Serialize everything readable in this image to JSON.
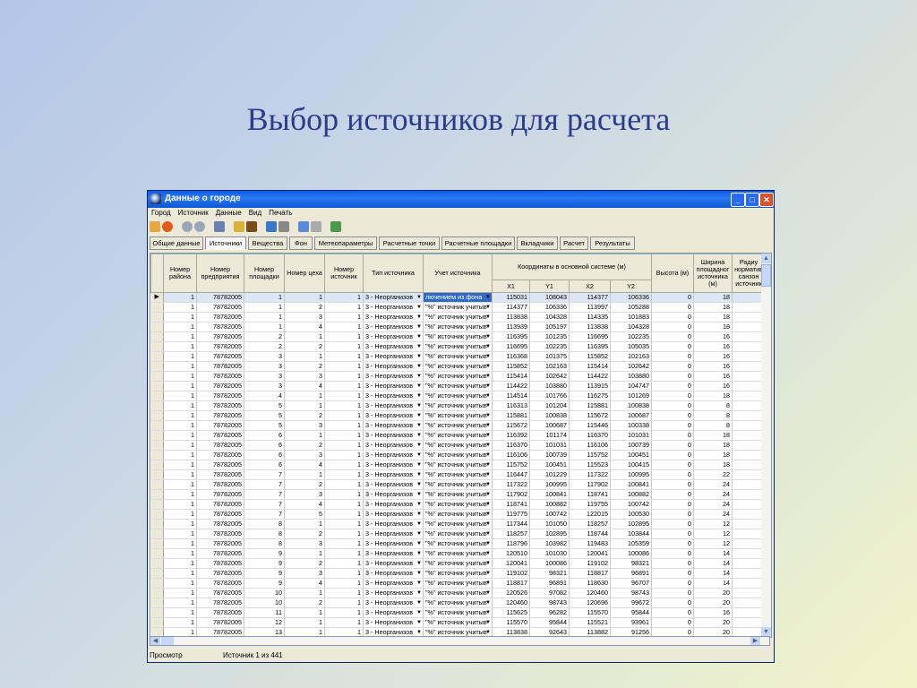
{
  "slide": {
    "title": "Выбор источников для расчета"
  },
  "window": {
    "title": "Данные о городе"
  },
  "menu": [
    "Город",
    "Источник",
    "Данные",
    "Вид",
    "Печать"
  ],
  "tabs": [
    {
      "label": "Общие данные",
      "active": false
    },
    {
      "label": "Источники",
      "active": true
    },
    {
      "label": "Вещества",
      "active": false
    },
    {
      "label": "Фон",
      "active": false
    },
    {
      "label": "Метеопараметры",
      "active": false
    },
    {
      "label": "Расчетные точки",
      "active": false
    },
    {
      "label": "Расчетные площадки",
      "active": false
    },
    {
      "label": "Вкладчики",
      "active": false
    },
    {
      "label": "Расчет",
      "active": false
    },
    {
      "label": "Результаты",
      "active": false
    }
  ],
  "table": {
    "headers": {
      "district": "Номер района",
      "enterprise": "Номер предприятия",
      "site": "Номер площадки",
      "shop": "Номер цеха",
      "source": "Номер источник",
      "type": "Тип источника",
      "accounting": "Учет источника",
      "coords": "Координаты в основной системе (м)",
      "x1": "X1",
      "y1": "Y1",
      "x2": "X2",
      "y2": "Y2",
      "height": "Высота (м)",
      "width": "Ширина площадног источника (м)",
      "radius": "Радиу норматив санзон источник"
    },
    "type_value": "3 - Неорганизов",
    "accounting_selected": "лючением из фона",
    "accounting_value": "\"%\" источник учитыв",
    "rows": [
      [
        "1",
        "78782005",
        "1",
        "1",
        "1",
        "115031",
        "108043",
        "114377",
        "106336",
        "0",
        "18"
      ],
      [
        "1",
        "78782005",
        "1",
        "2",
        "1",
        "114377",
        "106336",
        "113997",
        "105288",
        "0",
        "18"
      ],
      [
        "1",
        "78782005",
        "1",
        "3",
        "1",
        "113838",
        "104328",
        "114335",
        "101883",
        "0",
        "18"
      ],
      [
        "1",
        "78782005",
        "1",
        "4",
        "1",
        "113939",
        "105197",
        "113838",
        "104328",
        "0",
        "18"
      ],
      [
        "1",
        "78782005",
        "2",
        "1",
        "1",
        "116395",
        "101235",
        "116695",
        "102235",
        "0",
        "16"
      ],
      [
        "1",
        "78782005",
        "2",
        "2",
        "1",
        "116695",
        "102235",
        "116395",
        "105035",
        "0",
        "16"
      ],
      [
        "1",
        "78782005",
        "3",
        "1",
        "1",
        "116368",
        "101375",
        "115852",
        "102163",
        "0",
        "16"
      ],
      [
        "1",
        "78782005",
        "3",
        "2",
        "1",
        "115852",
        "102163",
        "115414",
        "102642",
        "0",
        "16"
      ],
      [
        "1",
        "78782005",
        "3",
        "3",
        "1",
        "115414",
        "102642",
        "114422",
        "103880",
        "0",
        "16"
      ],
      [
        "1",
        "78782005",
        "3",
        "4",
        "1",
        "114422",
        "103880",
        "113915",
        "104747",
        "0",
        "16"
      ],
      [
        "1",
        "78782005",
        "4",
        "1",
        "1",
        "114514",
        "101766",
        "116275",
        "101269",
        "0",
        "18"
      ],
      [
        "1",
        "78782005",
        "5",
        "1",
        "1",
        "116313",
        "101204",
        "115881",
        "100838",
        "0",
        "8"
      ],
      [
        "1",
        "78782005",
        "5",
        "2",
        "1",
        "115881",
        "100838",
        "115672",
        "100687",
        "0",
        "8"
      ],
      [
        "1",
        "78782005",
        "5",
        "3",
        "1",
        "115672",
        "100687",
        "115446",
        "100338",
        "0",
        "8"
      ],
      [
        "1",
        "78782005",
        "6",
        "1",
        "1",
        "116392",
        "101174",
        "116370",
        "101031",
        "0",
        "18"
      ],
      [
        "1",
        "78782005",
        "6",
        "2",
        "1",
        "116370",
        "101031",
        "116106",
        "100739",
        "0",
        "18"
      ],
      [
        "1",
        "78782005",
        "6",
        "3",
        "1",
        "116106",
        "100739",
        "115752",
        "100451",
        "0",
        "18"
      ],
      [
        "1",
        "78782005",
        "6",
        "4",
        "1",
        "115752",
        "100451",
        "115523",
        "100415",
        "0",
        "18"
      ],
      [
        "1",
        "78782005",
        "7",
        "1",
        "1",
        "116447",
        "101229",
        "117322",
        "100995",
        "0",
        "22"
      ],
      [
        "1",
        "78782005",
        "7",
        "2",
        "1",
        "117322",
        "100995",
        "117902",
        "100841",
        "0",
        "24"
      ],
      [
        "1",
        "78782005",
        "7",
        "3",
        "1",
        "117902",
        "100841",
        "118741",
        "100882",
        "0",
        "24"
      ],
      [
        "1",
        "78782005",
        "7",
        "4",
        "1",
        "118741",
        "100882",
        "119755",
        "100742",
        "0",
        "24"
      ],
      [
        "1",
        "78782005",
        "7",
        "5",
        "1",
        "119775",
        "100742",
        "122015",
        "100530",
        "0",
        "24"
      ],
      [
        "1",
        "78782005",
        "8",
        "1",
        "1",
        "117344",
        "101050",
        "118257",
        "102895",
        "0",
        "12"
      ],
      [
        "1",
        "78782005",
        "8",
        "2",
        "1",
        "118257",
        "102895",
        "118744",
        "103844",
        "0",
        "12"
      ],
      [
        "1",
        "78782005",
        "8",
        "3",
        "1",
        "118796",
        "103982",
        "119483",
        "105359",
        "0",
        "12"
      ],
      [
        "1",
        "78782005",
        "9",
        "1",
        "1",
        "120510",
        "101030",
        "120041",
        "100086",
        "0",
        "14"
      ],
      [
        "1",
        "78782005",
        "9",
        "2",
        "1",
        "120041",
        "100086",
        "119102",
        "98321",
        "0",
        "14"
      ],
      [
        "1",
        "78782005",
        "9",
        "3",
        "1",
        "119102",
        "98321",
        "118817",
        "96891",
        "0",
        "14"
      ],
      [
        "1",
        "78782005",
        "9",
        "4",
        "1",
        "118817",
        "96891",
        "118630",
        "96707",
        "0",
        "14"
      ],
      [
        "1",
        "78782005",
        "10",
        "1",
        "1",
        "120526",
        "97082",
        "120460",
        "98743",
        "0",
        "20"
      ],
      [
        "1",
        "78782005",
        "10",
        "2",
        "1",
        "120460",
        "98743",
        "120696",
        "99672",
        "0",
        "20"
      ],
      [
        "1",
        "78782005",
        "11",
        "1",
        "1",
        "115625",
        "96282",
        "115570",
        "95844",
        "0",
        "16"
      ],
      [
        "1",
        "78782005",
        "12",
        "1",
        "1",
        "115570",
        "95844",
        "115521",
        "93961",
        "0",
        "20"
      ],
      [
        "1",
        "78782005",
        "13",
        "1",
        "1",
        "113838",
        "92643",
        "113882",
        "91256",
        "0",
        "20"
      ]
    ]
  },
  "status": {
    "mode": "Просмотр",
    "record": "Источник 1 из 441"
  }
}
